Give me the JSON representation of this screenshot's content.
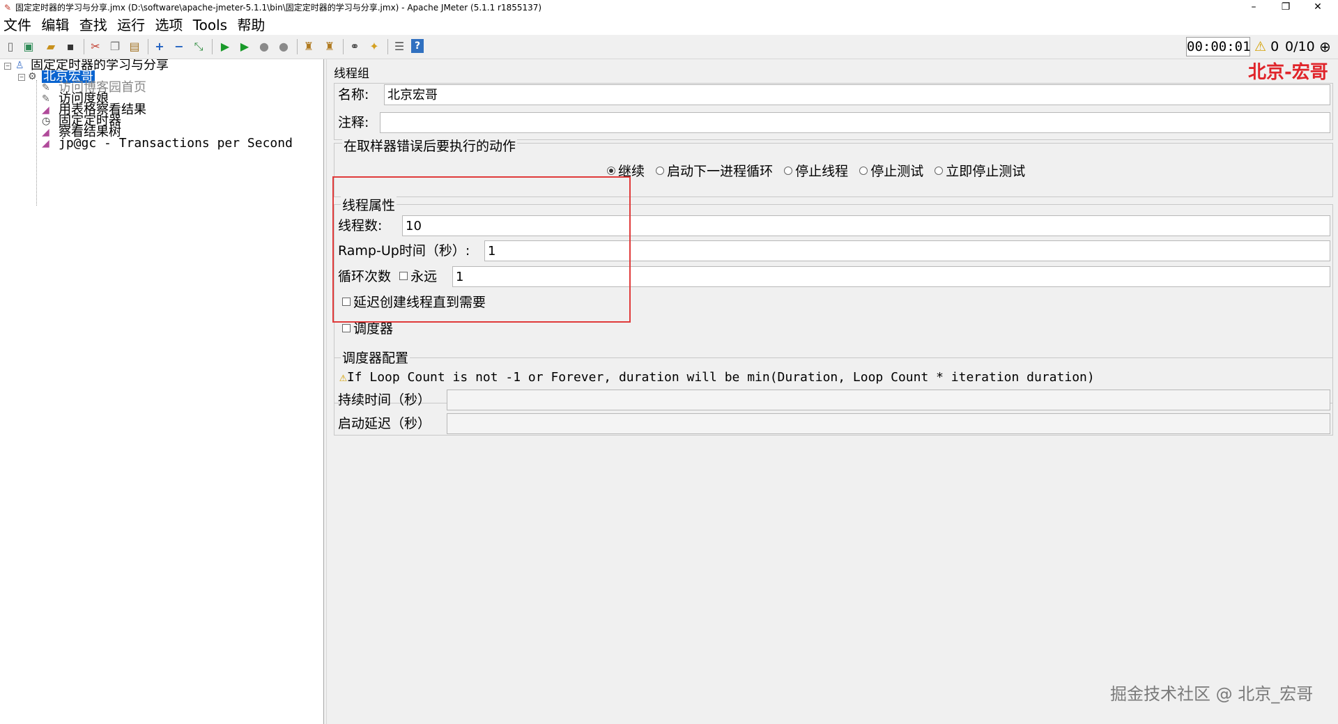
{
  "window": {
    "title": "固定定时器的学习与分享.jmx (D:\\software\\apache-jmeter-5.1.1\\bin\\固定定时器的学习与分享.jmx) - Apache JMeter (5.1.1 r1855137)",
    "minimize": "–",
    "restore": "❐",
    "close": "✕"
  },
  "menu": [
    "文件",
    "编辑",
    "查找",
    "运行",
    "选项",
    "Tools",
    "帮助"
  ],
  "toolbar": {
    "timer": "00:00:01",
    "warn_count": "0",
    "threads": "0/10"
  },
  "tree": {
    "root": "固定定时器的学习与分享",
    "thread_group": "北京宏哥",
    "children": [
      "访问博客园首页",
      "访问度娘",
      "用表格察看结果",
      "固定定时器",
      "察看结果树",
      "jp@gc - Transactions per Second"
    ]
  },
  "panel": {
    "header": "线程组",
    "brand": "北京-宏哥",
    "name_label": "名称:",
    "name_value": "北京宏哥",
    "comment_label": "注释:",
    "comment_value": "",
    "error_action_title": "在取样器错误后要执行的动作",
    "error_actions": [
      "继续",
      "启动下一进程循环",
      "停止线程",
      "停止测试",
      "立即停止测试"
    ],
    "selected_error_action": "继续",
    "thread_props_title": "线程属性",
    "threads_label": "线程数:",
    "threads_value": "10",
    "rampup_label": "Ramp-Up时间（秒）:",
    "rampup_value": "1",
    "loop_label": "循环次数",
    "forever_label": "永远",
    "loop_value": "1",
    "delay_label": "延迟创建线程直到需要",
    "scheduler_label": "调度器",
    "scheduler_config_title": "调度器配置",
    "scheduler_warning": "If Loop Count is not -1 or Forever, duration will be min(Duration, Loop Count * iteration duration)",
    "duration_label": "持续时间（秒）",
    "duration_value": "",
    "startup_delay_label": "启动延迟（秒）",
    "startup_delay_value": "",
    "watermark": "掘金技术社区 @ 北京_宏哥"
  }
}
